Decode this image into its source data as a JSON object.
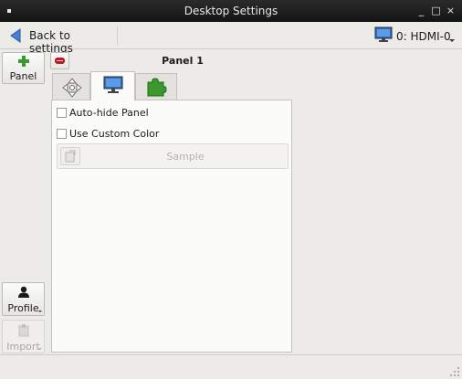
{
  "window": {
    "title": "Desktop Settings",
    "minimize_glyph": "_",
    "maximize_glyph": "□",
    "close_glyph": "×"
  },
  "toolbar": {
    "back_label": "Back to settings",
    "monitor_label": "0: HDMI-0"
  },
  "sidebar": {
    "panel_label": "Panel",
    "profile_label": "Profile",
    "import_label": "Import"
  },
  "panel": {
    "title": "Panel 1",
    "tabs": [
      {
        "name": "layout",
        "icon": "move-arrows-icon",
        "active": false
      },
      {
        "name": "appearance",
        "icon": "monitor-icon",
        "active": true
      },
      {
        "name": "plugins",
        "icon": "puzzle-piece-icon",
        "active": false
      }
    ],
    "options": {
      "auto_hide_label": "Auto-hide Panel",
      "auto_hide_checked": false,
      "custom_color_label": "Use Custom Color",
      "custom_color_checked": false,
      "sample_label": "Sample"
    }
  },
  "colors": {
    "titlebar": "#1e1e1e",
    "window_bg": "#ecebe8",
    "add_green": "#3a9a2e",
    "remove_red": "#c0181e",
    "monitor_blue": "#2f6fc4"
  }
}
